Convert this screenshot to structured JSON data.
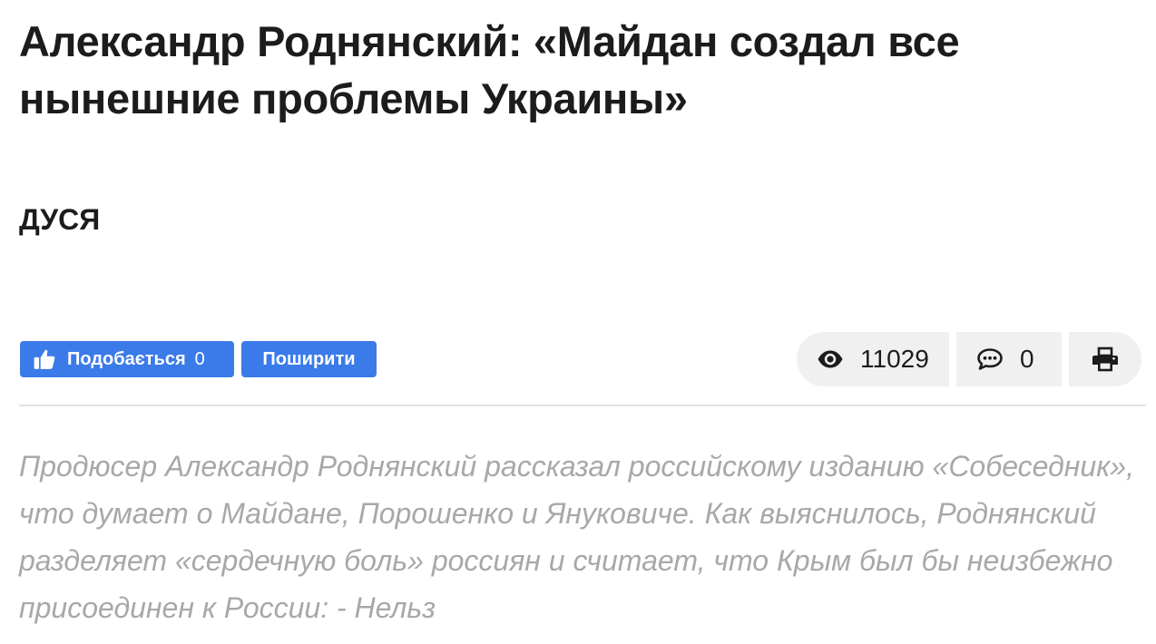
{
  "article": {
    "title": "Александр Роднянский: «Майдан создал все нынешние проблемы Украины»",
    "author": "ДУСЯ",
    "lead": "Продюсер Александр Роднянский рассказал российскому изданию «Собеседник», что думает о Майдане, Порошенко и Януковиче. Как выяснилось, Роднянский разделяет «сердечную боль» россиян и считает, что Крым был бы неизбежно присоединен к России: - Нельз"
  },
  "social": {
    "like_label": "Подобається",
    "like_count": "0",
    "share_label": "Поширити",
    "like_icon": "thumbs-up-icon",
    "accent_color": "#3b7be9"
  },
  "stats": {
    "views": "11029",
    "comments": "0",
    "views_icon": "eye-icon",
    "comments_icon": "comment-icon",
    "print_icon": "printer-icon"
  }
}
